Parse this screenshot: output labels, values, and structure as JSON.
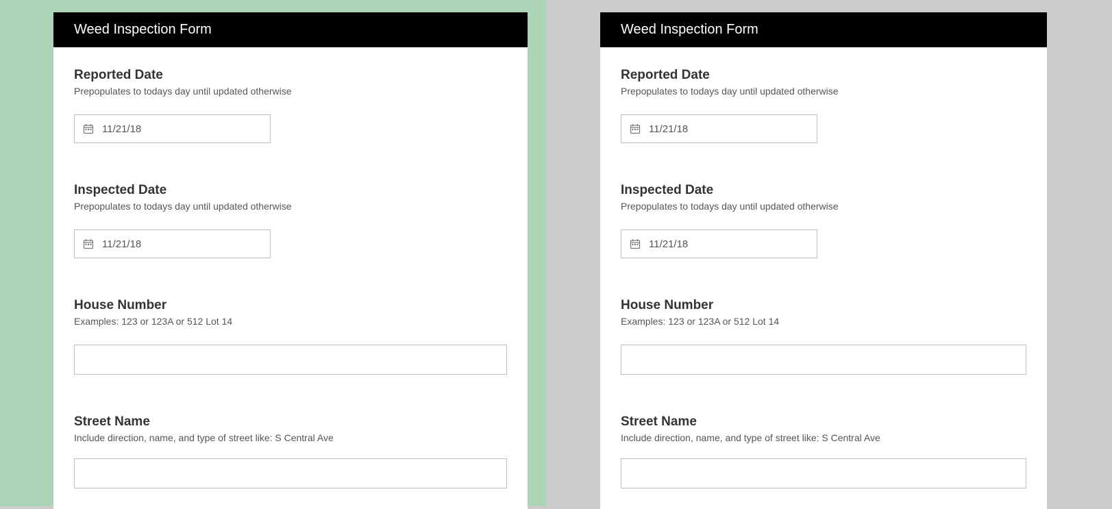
{
  "forms": [
    {
      "title": "Weed Inspection Form",
      "fields": {
        "reportedDate": {
          "label": "Reported Date",
          "hint": "Prepopulates to todays day until updated otherwise",
          "value": "11/21/18"
        },
        "inspectedDate": {
          "label": "Inspected Date",
          "hint": "Prepopulates to todays day until updated otherwise",
          "value": "11/21/18"
        },
        "houseNumber": {
          "label": "House Number",
          "hint": "Examples: 123 or 123A or 512 Lot 14",
          "value": ""
        },
        "streetName": {
          "label": "Street Name",
          "hint": "Include direction, name, and type of street like: S Central Ave",
          "value": ""
        }
      }
    },
    {
      "title": "Weed Inspection Form",
      "fields": {
        "reportedDate": {
          "label": "Reported Date",
          "hint": "Prepopulates to todays day until updated otherwise",
          "value": "11/21/18"
        },
        "inspectedDate": {
          "label": "Inspected Date",
          "hint": "Prepopulates to todays day until updated otherwise",
          "value": "11/21/18"
        },
        "houseNumber": {
          "label": "House Number",
          "hint": "Examples: 123 or 123A or 512 Lot 14",
          "value": ""
        },
        "streetName": {
          "label": "Street Name",
          "hint": "Include direction, name, and type of street like: S Central Ave",
          "value": ""
        }
      }
    }
  ]
}
